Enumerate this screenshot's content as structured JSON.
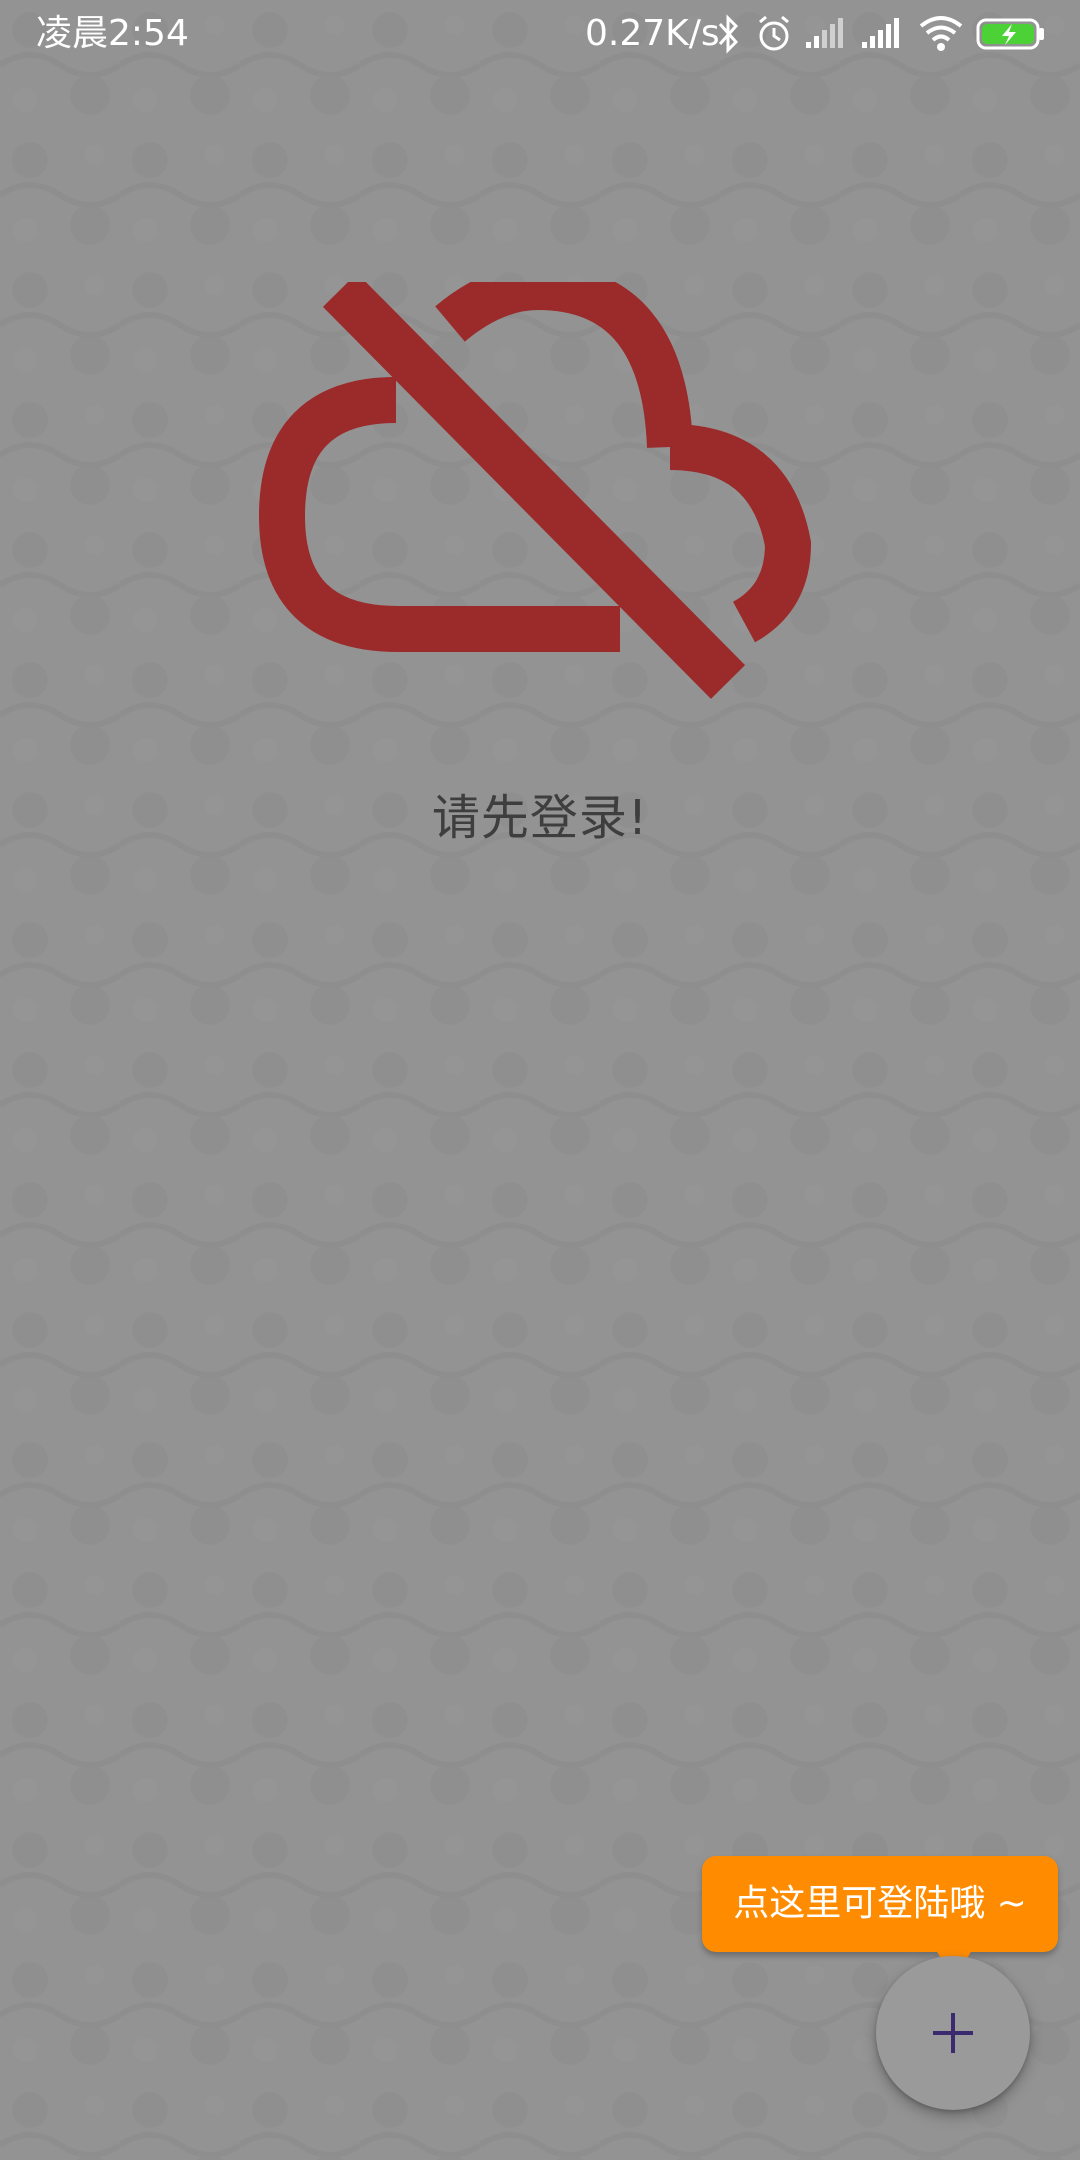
{
  "status_bar": {
    "time": "凌晨2:54",
    "network_speed": "0.27K/s",
    "icons": [
      "bluetooth-icon",
      "alarm-icon",
      "signal-icon",
      "signal-icon",
      "wifi-icon",
      "battery-charging-icon"
    ]
  },
  "empty_state": {
    "icon": "cloud-off-icon",
    "message": "请先登录!"
  },
  "tooltip": {
    "text": "点这里可登陆哦 ~"
  },
  "fab": {
    "icon": "plus-icon"
  },
  "colors": {
    "background": "#939393",
    "accent_red": "#9b2a2a",
    "tooltip": "#ff8c00",
    "fab_plus": "#3c2a6e",
    "battery_green": "#4cd137"
  }
}
